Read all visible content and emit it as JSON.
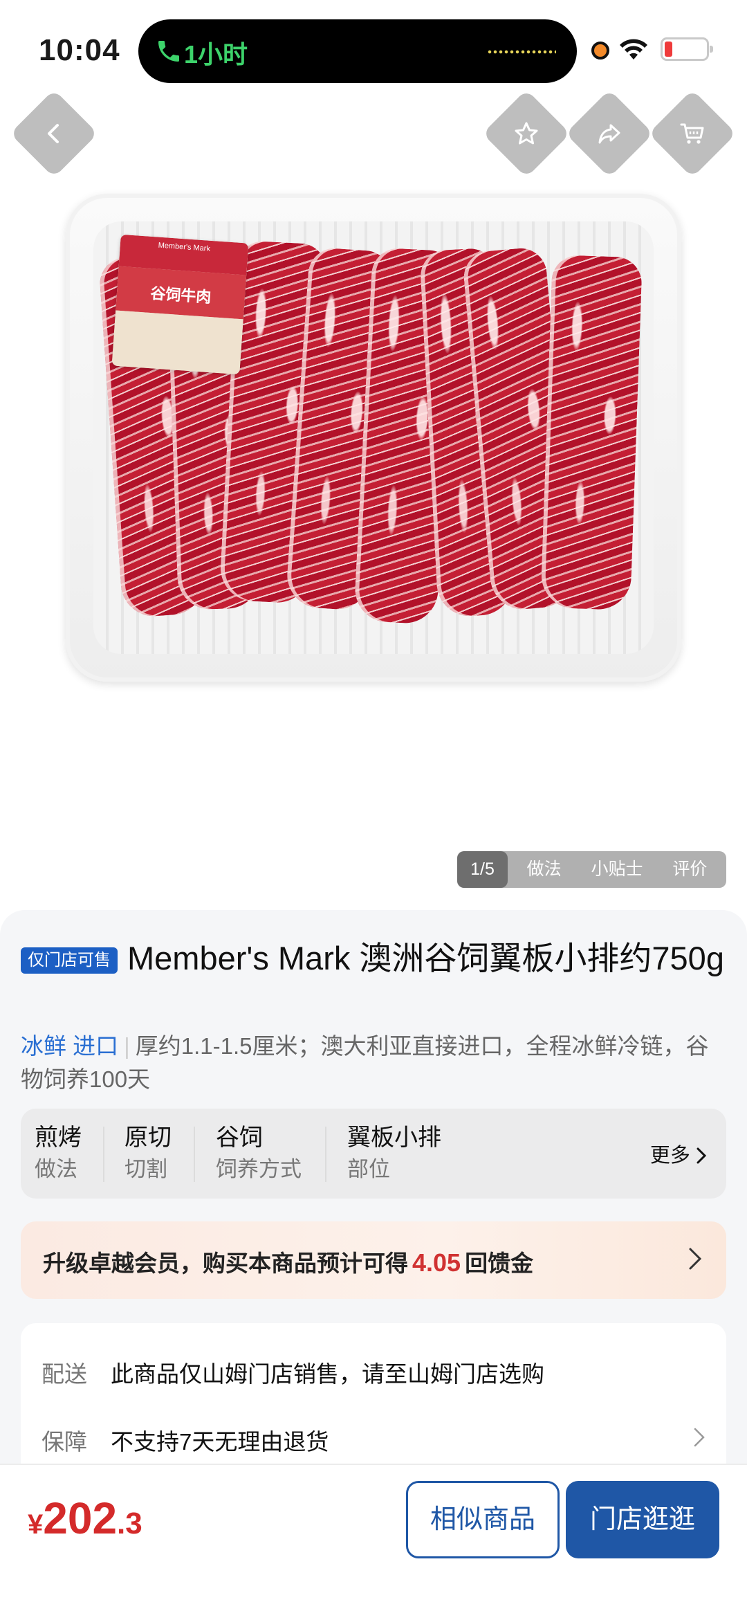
{
  "status_bar": {
    "time": "10:04",
    "call_duration": "1小时"
  },
  "gallery": {
    "tabs": [
      {
        "label": "1/5"
      },
      {
        "label": "做法"
      },
      {
        "label": "小贴士"
      },
      {
        "label": "评价"
      }
    ],
    "package_label": "谷饲牛肉"
  },
  "product": {
    "badge": "仅门店可售",
    "title": "Member's Mark 澳洲谷饲翼板小排约750g",
    "tags": [
      "冰鲜",
      "进口"
    ],
    "description": "厚约1.1-1.5厘米；澳大利亚直接进口，全程冰鲜冷链，谷物饲养100天"
  },
  "attributes": {
    "items": [
      {
        "value": "煎烤",
        "key": "做法"
      },
      {
        "value": "原切",
        "key": "切割"
      },
      {
        "value": "谷饲",
        "key": "饲养方式"
      },
      {
        "value": "翼板小排",
        "key": "部位"
      }
    ],
    "more_label": "更多"
  },
  "promo": {
    "prefix": "升级卓越会员，购买本商品预计可得",
    "amount": "4.05",
    "suffix": "回馈金"
  },
  "service": {
    "rows": [
      {
        "key": "配送",
        "value": "此商品仅山姆门店销售，请至山姆门店选购"
      },
      {
        "key": "保障",
        "value": "不支持7天无理由退货"
      }
    ]
  },
  "bottom_bar": {
    "currency": "¥",
    "price_int": "202",
    "price_dec": ".3",
    "similar_label": "相似商品",
    "store_label": "门店逛逛"
  },
  "colors": {
    "accent_blue": "#1f57a6",
    "price_red": "#d42a2a",
    "tag_blue": "#2a6fd2"
  }
}
